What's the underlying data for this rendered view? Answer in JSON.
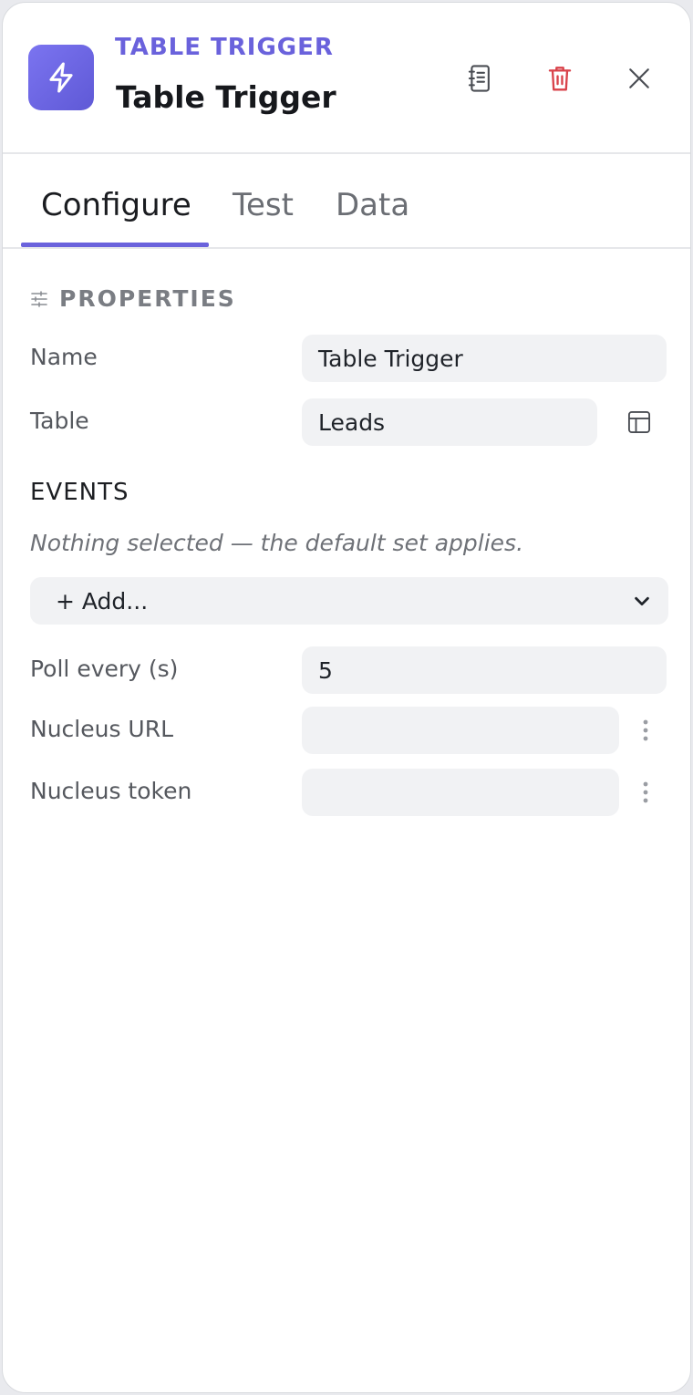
{
  "header": {
    "node_kind": "TABLE TRIGGER",
    "node_title": "Table Trigger",
    "icons": {
      "node": "lightning-bolt-icon",
      "notes": "notebook-icon",
      "delete": "trash-icon",
      "close": "close-icon"
    },
    "colors": {
      "accent": "#6a62dc",
      "danger": "#d9424a"
    }
  },
  "tabs": [
    {
      "label": "Configure",
      "active": true
    },
    {
      "label": "Test",
      "active": false
    },
    {
      "label": "Data",
      "active": false
    }
  ],
  "properties": {
    "section_title": "PROPERTIES",
    "name": {
      "label": "Name",
      "value": "Table Trigger"
    },
    "table": {
      "label": "Table",
      "value": "Leads",
      "icon": "table-icon"
    }
  },
  "events": {
    "title": "EVENTS",
    "hint": "Nothing selected — the default set applies.",
    "add_label": "+ Add..."
  },
  "fields": {
    "poll": {
      "label": "Poll every (s)",
      "value": "5"
    },
    "nucleus_url": {
      "label": "Nucleus URL",
      "value": ""
    },
    "nucleus_token": {
      "label": "Nucleus token",
      "value": ""
    }
  }
}
